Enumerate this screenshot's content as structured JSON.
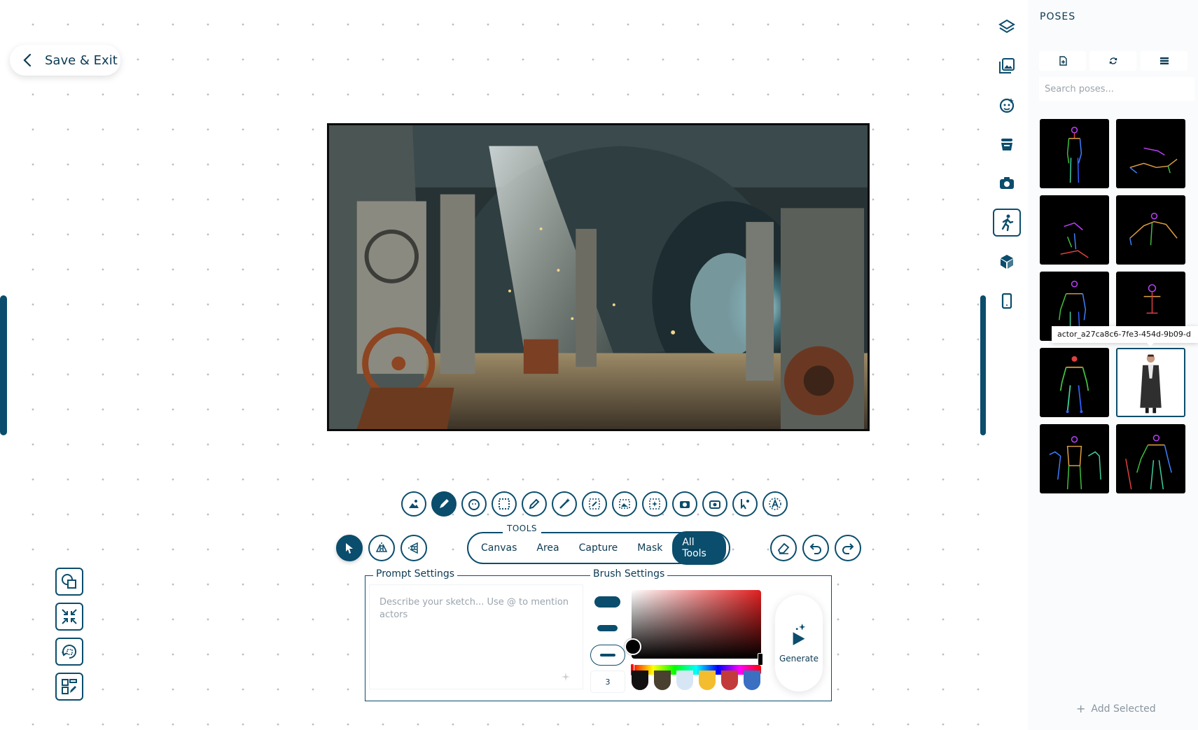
{
  "header": {
    "save_exit_label": "Save & Exit"
  },
  "tools": {
    "group_label": "TOOLS",
    "tabs": [
      "Canvas",
      "Area",
      "Capture",
      "Mask",
      "All Tools"
    ],
    "active_tab": "All Tools"
  },
  "prompt_settings": {
    "label": "Prompt Settings",
    "placeholder": "Describe your sketch... Use @ to mention actors"
  },
  "brush_settings": {
    "label": "Brush Settings",
    "size_value": "3",
    "swatches": [
      "#111111",
      "#4a4030",
      "#d6e6f5",
      "#f3bd2e",
      "#c23a3a",
      "#3a6fc2"
    ]
  },
  "generate": {
    "label": "Generate"
  },
  "poses": {
    "title": "POSES",
    "search_placeholder": "Search poses...",
    "tooltip": "actor_a27ca8c6-7fe3-454d-9b09-d",
    "add_selected_label": "Add Selected"
  },
  "colors": {
    "accent": "#0b4d6c"
  }
}
